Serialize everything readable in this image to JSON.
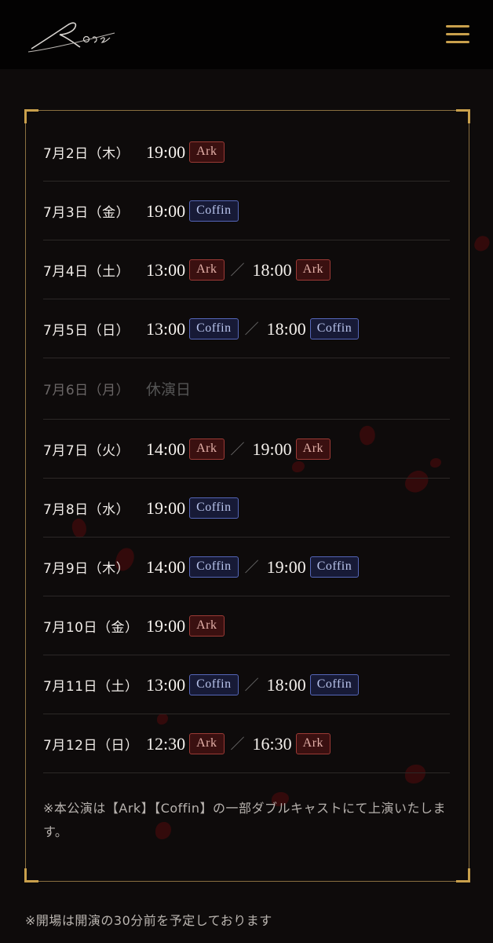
{
  "header": {
    "logo_text": "Rose"
  },
  "schedule": [
    {
      "date": "7月2日（木）",
      "slots": [
        {
          "time": "19:00",
          "cast": "Ark",
          "type": "ark"
        }
      ]
    },
    {
      "date": "7月3日（金）",
      "slots": [
        {
          "time": "19:00",
          "cast": "Coffin",
          "type": "coffin"
        }
      ]
    },
    {
      "date": "7月4日（土）",
      "slots": [
        {
          "time": "13:00",
          "cast": "Ark",
          "type": "ark"
        },
        {
          "time": "18:00",
          "cast": "Ark",
          "type": "ark"
        }
      ]
    },
    {
      "date": "7月5日（日）",
      "slots": [
        {
          "time": "13:00",
          "cast": "Coffin",
          "type": "coffin"
        },
        {
          "time": "18:00",
          "cast": "Coffin",
          "type": "coffin"
        }
      ]
    },
    {
      "date": "7月6日（月）",
      "off": "休演日"
    },
    {
      "date": "7月7日（火）",
      "slots": [
        {
          "time": "14:00",
          "cast": "Ark",
          "type": "ark"
        },
        {
          "time": "19:00",
          "cast": "Ark",
          "type": "ark"
        }
      ]
    },
    {
      "date": "7月8日（水）",
      "slots": [
        {
          "time": "19:00",
          "cast": "Coffin",
          "type": "coffin"
        }
      ]
    },
    {
      "date": "7月9日（木）",
      "slots": [
        {
          "time": "14:00",
          "cast": "Coffin",
          "type": "coffin"
        },
        {
          "time": "19:00",
          "cast": "Coffin",
          "type": "coffin"
        }
      ]
    },
    {
      "date": "7月10日（金）",
      "slots": [
        {
          "time": "19:00",
          "cast": "Ark",
          "type": "ark"
        }
      ]
    },
    {
      "date": "7月11日（土）",
      "slots": [
        {
          "time": "13:00",
          "cast": "Coffin",
          "type": "coffin"
        },
        {
          "time": "18:00",
          "cast": "Coffin",
          "type": "coffin"
        }
      ]
    },
    {
      "date": "7月12日（日）",
      "slots": [
        {
          "time": "12:30",
          "cast": "Ark",
          "type": "ark"
        },
        {
          "time": "16:30",
          "cast": "Ark",
          "type": "ark"
        }
      ]
    }
  ],
  "separator": "／",
  "note": "※本公演は【Ark】【Coffin】の一部ダブルキャストにて上演いたします。",
  "footer_note": "※開場は開演の30分前を予定しております",
  "colors": {
    "gold": "#c9a04c",
    "ark": "#9b3a35",
    "coffin": "#5566b8",
    "background": "#0e0b0b"
  }
}
